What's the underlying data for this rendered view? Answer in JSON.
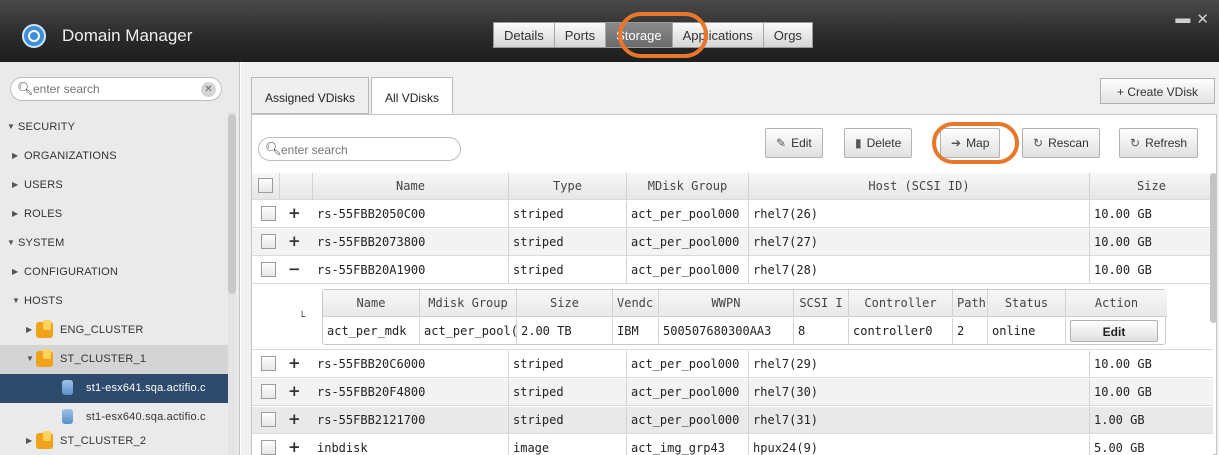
{
  "app": {
    "title": "Domain Manager",
    "tabs": [
      {
        "label": "Details",
        "active": false
      },
      {
        "label": "Ports",
        "active": false
      },
      {
        "label": "Storage",
        "active": true
      },
      {
        "label": "Applications",
        "active": false
      },
      {
        "label": "Orgs",
        "active": false
      }
    ],
    "window_buttons": [
      "▬",
      "✕"
    ],
    "highlight_color": "#e9772b"
  },
  "sidebar": {
    "search_placeholder": "enter search",
    "items": [
      {
        "label": "SECURITY",
        "arrow": "▼"
      },
      {
        "label": "ORGANIZATIONS",
        "arrow": "▶"
      },
      {
        "label": "USERS",
        "arrow": "▶"
      },
      {
        "label": "ROLES",
        "arrow": "▶"
      },
      {
        "label": "SYSTEM",
        "arrow": "▼"
      },
      {
        "label": "CONFIGURATION",
        "arrow": "▶"
      },
      {
        "label": "HOSTS",
        "arrow": "▼"
      },
      {
        "label": "ENG_CLUSTER",
        "arrow": "▶",
        "icon": "host-cluster-icon"
      },
      {
        "label": "ST_CLUSTER_1",
        "arrow": "▼",
        "icon": "host-cluster-icon"
      },
      {
        "label": "st1-esx641.sqa.actifio.c",
        "icon": "host-disk-icon",
        "active": true
      },
      {
        "label": "st1-esx640.sqa.actifio.c",
        "icon": "host-disk-icon"
      },
      {
        "label": "ST_CLUSTER_2",
        "arrow": "▶",
        "icon": "host-cluster-icon"
      }
    ]
  },
  "main": {
    "subtabs": [
      {
        "label": "Assigned VDisks",
        "active": false
      },
      {
        "label": "All VDisks",
        "active": true
      }
    ],
    "create_button": "+ Create VDisk",
    "search_placeholder": "enter search",
    "toolbar": {
      "edit": "Edit",
      "delete": "Delete",
      "map": "Map",
      "rescan": "Rescan",
      "refresh": "Refresh"
    },
    "columns": [
      "Name",
      "Type",
      "MDisk Group",
      "Host (SCSI ID)",
      "Size"
    ],
    "rows": [
      {
        "expander": "+",
        "name": "rs-55FBB2050C00",
        "type": "striped",
        "mdisk_group": "act_per_pool000",
        "host": "rhel7(26)",
        "size": "10.00 GB"
      },
      {
        "expander": "+",
        "name": "rs-55FBB2073800",
        "type": "striped",
        "mdisk_group": "act_per_pool000",
        "host": "rhel7(27)",
        "size": "10.00 GB"
      },
      {
        "expander": "−",
        "name": "rs-55FBB20A1900",
        "type": "striped",
        "mdisk_group": "act_per_pool000",
        "host": "rhel7(28)",
        "size": "10.00 GB"
      },
      {
        "expander": "+",
        "name": "rs-55FBB20C6000",
        "type": "striped",
        "mdisk_group": "act_per_pool000",
        "host": "rhel7(29)",
        "size": "10.00 GB"
      },
      {
        "expander": "+",
        "name": "rs-55FBB20F4800",
        "type": "striped",
        "mdisk_group": "act_per_pool000",
        "host": "rhel7(30)",
        "size": "10.00 GB"
      },
      {
        "expander": "+",
        "name": "rs-55FBB2121700",
        "type": "striped",
        "mdisk_group": "act_per_pool000",
        "host": "rhel7(31)",
        "size": "1.00 GB"
      },
      {
        "expander": "+",
        "name": "inbdisk",
        "type": "image",
        "mdisk_group": "act_img_grp43",
        "host": "hpux24(9)",
        "size": "5.00 GB"
      }
    ],
    "detail": {
      "elbow": "└",
      "columns": [
        "Name",
        "Mdisk Group",
        "Size",
        "Vendc",
        "WWPN",
        "SCSI I",
        "Controller",
        "Path",
        "Status",
        "Action"
      ],
      "row": {
        "name": "act_per_mdk",
        "mdisk_group": "act_per_pool(",
        "size": "2.00 TB",
        "vendor": "IBM",
        "wwpn": "500507680300AA3",
        "scsi_id": "8",
        "controller": "controller0",
        "path": "2",
        "status": "online",
        "action": "Edit"
      }
    }
  }
}
